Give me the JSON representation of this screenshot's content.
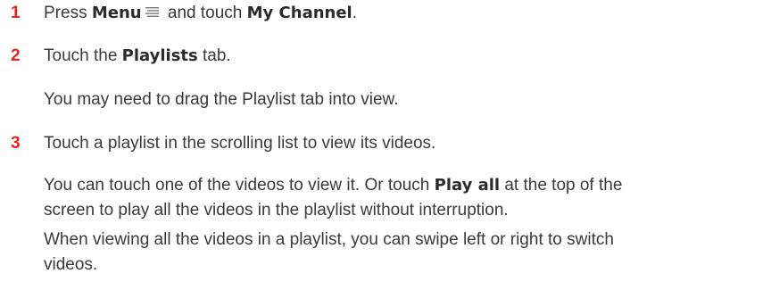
{
  "step1": {
    "number": "1",
    "part1": "Press ",
    "menu_label": "Menu",
    "menu_icon": "menu-icon",
    "part2": " and touch ",
    "channel_label": "My Channel",
    "end": "."
  },
  "step2": {
    "number": "2",
    "part1": "Touch the ",
    "tab_label": "Playlists",
    "part2": " tab.",
    "note": "You may need to drag the Playlist tab into view."
  },
  "step3": {
    "number": "3",
    "text": "Touch a playlist in the scrolling list to view its videos.",
    "note1_part1": "You can touch one of the videos to view it. Or touch ",
    "note1_bold": "Play all",
    "note1_part2": " at the top of the",
    "note1_line2": "screen to play all the videos in the playlist without interruption.",
    "note2_line1": "When viewing all the videos in a playlist, you can swipe left or right to switch",
    "note2_line2": "videos."
  },
  "colors": {
    "step_number": "#e8231f",
    "body_text": "#3a3a3a"
  }
}
